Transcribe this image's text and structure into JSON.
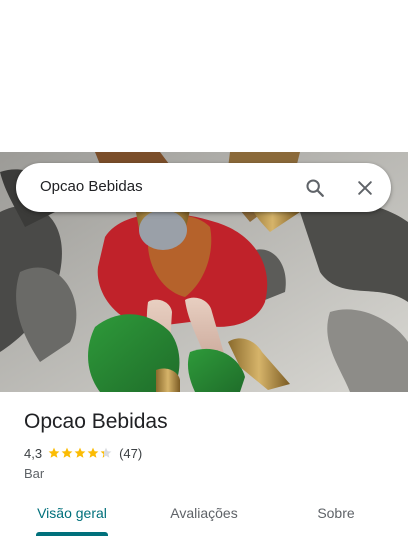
{
  "search": {
    "query": "Opcao Bebidas",
    "search_icon": "search-icon",
    "close_icon": "close-icon"
  },
  "photo": {
    "subject": "religious-figurine-photo"
  },
  "place": {
    "name": "Opcao Bebidas",
    "rating": "4,3",
    "rating_value": 4.3,
    "stars_max": 5,
    "review_count": "(47)",
    "category": "Bar"
  },
  "tabs": [
    {
      "label": "Visão geral",
      "selected": true
    },
    {
      "label": "Avaliações",
      "selected": false
    },
    {
      "label": "Sobre",
      "selected": false
    }
  ],
  "colors": {
    "accent": "#00707b",
    "star": "#fbbc04",
    "star_empty": "#dadce0",
    "text_primary": "#202124",
    "text_secondary": "#5f6368"
  }
}
